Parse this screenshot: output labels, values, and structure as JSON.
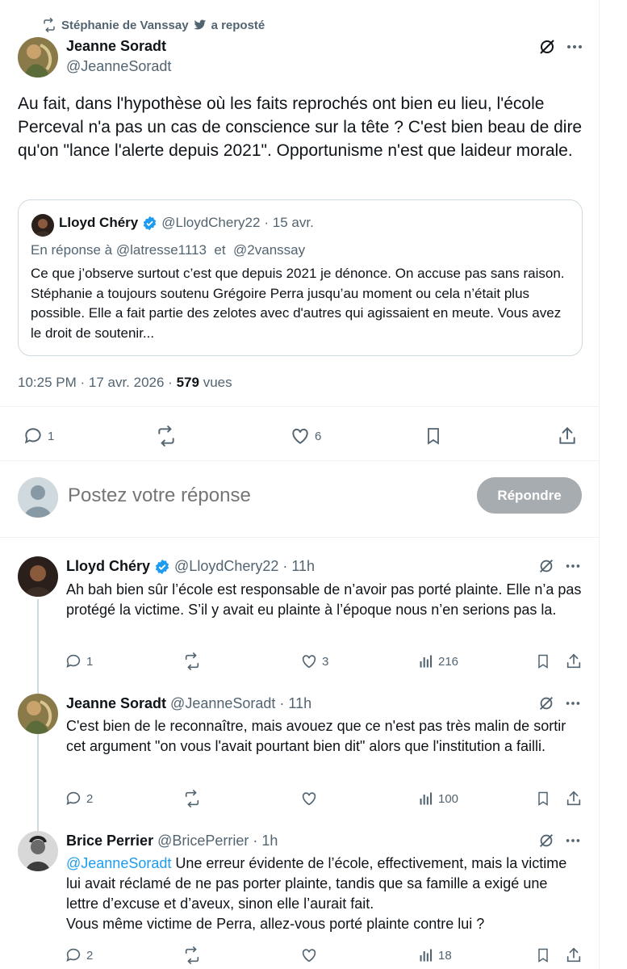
{
  "repost": {
    "text": "Stéphanie de Vanssay",
    "suffix": "a reposté"
  },
  "main_tweet": {
    "name": "Jeanne Soradt",
    "handle": "@JeanneSoradt",
    "body": "Au fait, dans l'hypothèse où les faits reprochés ont bien eu lieu, l'école Perceval n'a pas un cas de conscience sur la tête ? C'est bien beau de dire qu'on \"lance l'alerte depuis 2021\". Opportunisme n'est que laideur morale.",
    "quote": {
      "name": "Lloyd Chéry",
      "handle": "@LloydChery22",
      "date": "· 15 avr.",
      "reply_prefix": "En réponse à",
      "reply_to_1": "@latresse1113",
      "reply_and": "et",
      "reply_to_2": "@2vanssay",
      "body": "Ce que j’observe surtout c’est que depuis 2021 je dénonce. On accuse pas sans raison. Stéphanie a toujours soutenu Grégoire Perra jusqu’au moment ou cela n’était plus possible. Elle a fait partie des zelotes avec d'autres qui agissaient en meute. Vous avez le droit de soutenir..."
    },
    "timestamp": "10:25 PM · 17 avr. 2026 ·",
    "views_count": "579",
    "views_label": "vues",
    "actions": {
      "replies": "1",
      "reposts": "",
      "likes": "6"
    }
  },
  "composer": {
    "placeholder": "Postez votre réponse",
    "button": "Répondre"
  },
  "replies": [
    {
      "name": "Lloyd Chéry",
      "verified": true,
      "handle": "@LloydChery22",
      "time": "· 11h",
      "body": "Ah bah bien sûr l’école est responsable de n’avoir pas porté plainte. Elle n’a pas protégé la victime. S’il y avait eu plainte à l’époque nous n’en serions pas la.",
      "replies": "1",
      "reposts": "",
      "likes": "3",
      "views": "216"
    },
    {
      "name": "Jeanne Soradt",
      "verified": false,
      "handle": "@JeanneSoradt",
      "time": "· 11h",
      "body": "C'est bien de le reconnaître, mais avouez que ce n'est pas très malin  de sortir cet argument \"on vous l'avait pourtant bien dit\" alors que l'institution a failli.",
      "replies": "2",
      "reposts": "",
      "likes": "",
      "views": "100"
    },
    {
      "name": "Brice Perrier",
      "verified": false,
      "handle": "@BricePerrier",
      "time": "· 1h",
      "mention": "@JeanneSoradt",
      "body": " Une erreur évidente de l’école, effectivement, mais la victime lui avait réclamé de ne pas porter plainte, tandis que sa famille a exigé une lettre d’excuse et d’aveux, sinon elle l’aurait fait.",
      "body2": "Vous même victime de Perra, allez-vous porté plainte contre lui ?",
      "replies": "2",
      "reposts": "",
      "likes": "",
      "views": "18"
    }
  ],
  "colors": {
    "accent": "#1d9bf0",
    "muted": "#536471",
    "text": "#0f1419",
    "border": "#cfd9de",
    "button_disabled": "#a7acb0"
  },
  "icons": [
    "repost-icon",
    "bird-icon",
    "grok-icon",
    "more-icon",
    "reply-icon",
    "like-icon",
    "bookmark-icon",
    "share-icon",
    "views-icon",
    "verified-icon"
  ]
}
